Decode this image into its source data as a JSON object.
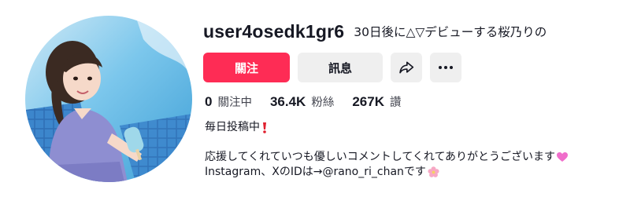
{
  "profile": {
    "username": "user4osedk1gr6",
    "nickname": "30日後に△▽デビューする桜乃りの"
  },
  "buttons": {
    "follow_label": "關注",
    "message_label": "訊息"
  },
  "icons": {
    "share": "share-arrow-icon",
    "more": "more-dots-icon",
    "emoji_exclamation": "red-exclamation-icon",
    "emoji_heart": "pink-heart-icon",
    "emoji_flower": "cherry-blossom-icon"
  },
  "stats": {
    "following_count": "0",
    "following_label": "關注中",
    "followers_count": "36.4K",
    "followers_label": "粉絲",
    "likes_count": "267K",
    "likes_label": "讚"
  },
  "bio": {
    "line1": "毎日投稿中",
    "line2": "応援してくれていつも優しいコメントしてくれてありがとうございます",
    "line3": "Instagram、XのIDは→@rano_ri_chanです"
  },
  "colors": {
    "accent": "#fe2c55",
    "button_secondary": "#efefef",
    "text_primary": "#161823"
  }
}
